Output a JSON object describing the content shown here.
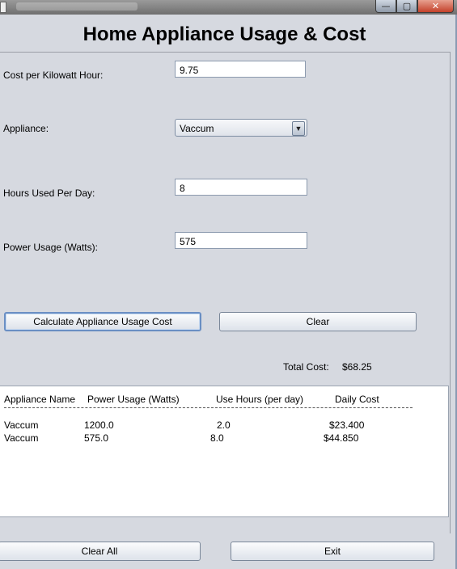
{
  "window": {
    "minimize_glyph": "—",
    "maximize_glyph": "▢",
    "close_glyph": "✕"
  },
  "app": {
    "title": "Home Appliance Usage & Cost"
  },
  "form": {
    "cost_label": "Cost per Kilowatt Hour:",
    "cost_value": "9.75",
    "appliance_label": "Appliance:",
    "appliance_selected": "Vaccum",
    "hours_label": "Hours Used Per Day:",
    "hours_value": "8",
    "power_label": "Power Usage (Watts):",
    "power_value": "575"
  },
  "buttons": {
    "calculate": "Calculate Appliance Usage Cost",
    "clear": "Clear",
    "clear_all": "Clear All",
    "exit": "Exit"
  },
  "total": {
    "label": "Total Cost:",
    "value": "$68.25"
  },
  "results": {
    "headers": [
      "Appliance Name",
      "Power Usage (Watts)",
      "Use Hours (per day)",
      "Daily Cost"
    ],
    "rows": [
      [
        "Vaccum",
        "1200.0",
        "2.0",
        "$23.400"
      ],
      [
        "Vaccum",
        "575.0",
        "8.0",
        "$44.850"
      ]
    ]
  },
  "icons": {
    "dropdown": "chevron-down-icon"
  }
}
